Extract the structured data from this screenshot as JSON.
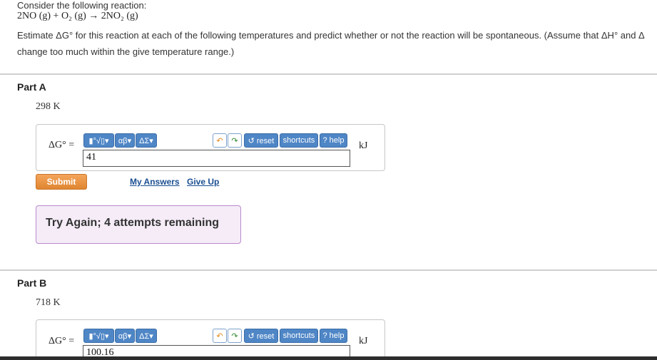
{
  "question": {
    "intro": "Consider the following reaction:",
    "reaction": "2NO (g) + O₂ (g)  →  2NO₂ (g)",
    "prompt_line1": "Estimate ΔG° for this reaction at each of the following temperatures and predict whether or not the reaction will be spontaneous. (Assume that ΔH° and Δ",
    "prompt_line2": "change too much within the give temperature range.)"
  },
  "toolbar": {
    "templates": "▮°√▯▾",
    "greek": "αβ▾",
    "symbols": "ΔΣ▾",
    "undo": "↶",
    "redo": "↷",
    "reset": "↺ reset",
    "shortcuts": "shortcuts",
    "help": "? help"
  },
  "part_a": {
    "title": "Part A",
    "temperature": "298 K",
    "label": "ΔG° =",
    "value": "41",
    "unit": "kJ",
    "submit": "Submit",
    "my_answers": "My Answers",
    "give_up": "Give Up",
    "feedback": "Try Again; 4 attempts remaining"
  },
  "part_b": {
    "title": "Part B",
    "temperature": "718 K",
    "label": "ΔG° =",
    "value": "100.16",
    "unit": "kJ"
  },
  "colors": {
    "toolbar_blue": "#4f86c6",
    "submit_orange": "#e08631",
    "feedback_border": "#b98acb",
    "link_blue": "#1a4e91"
  }
}
